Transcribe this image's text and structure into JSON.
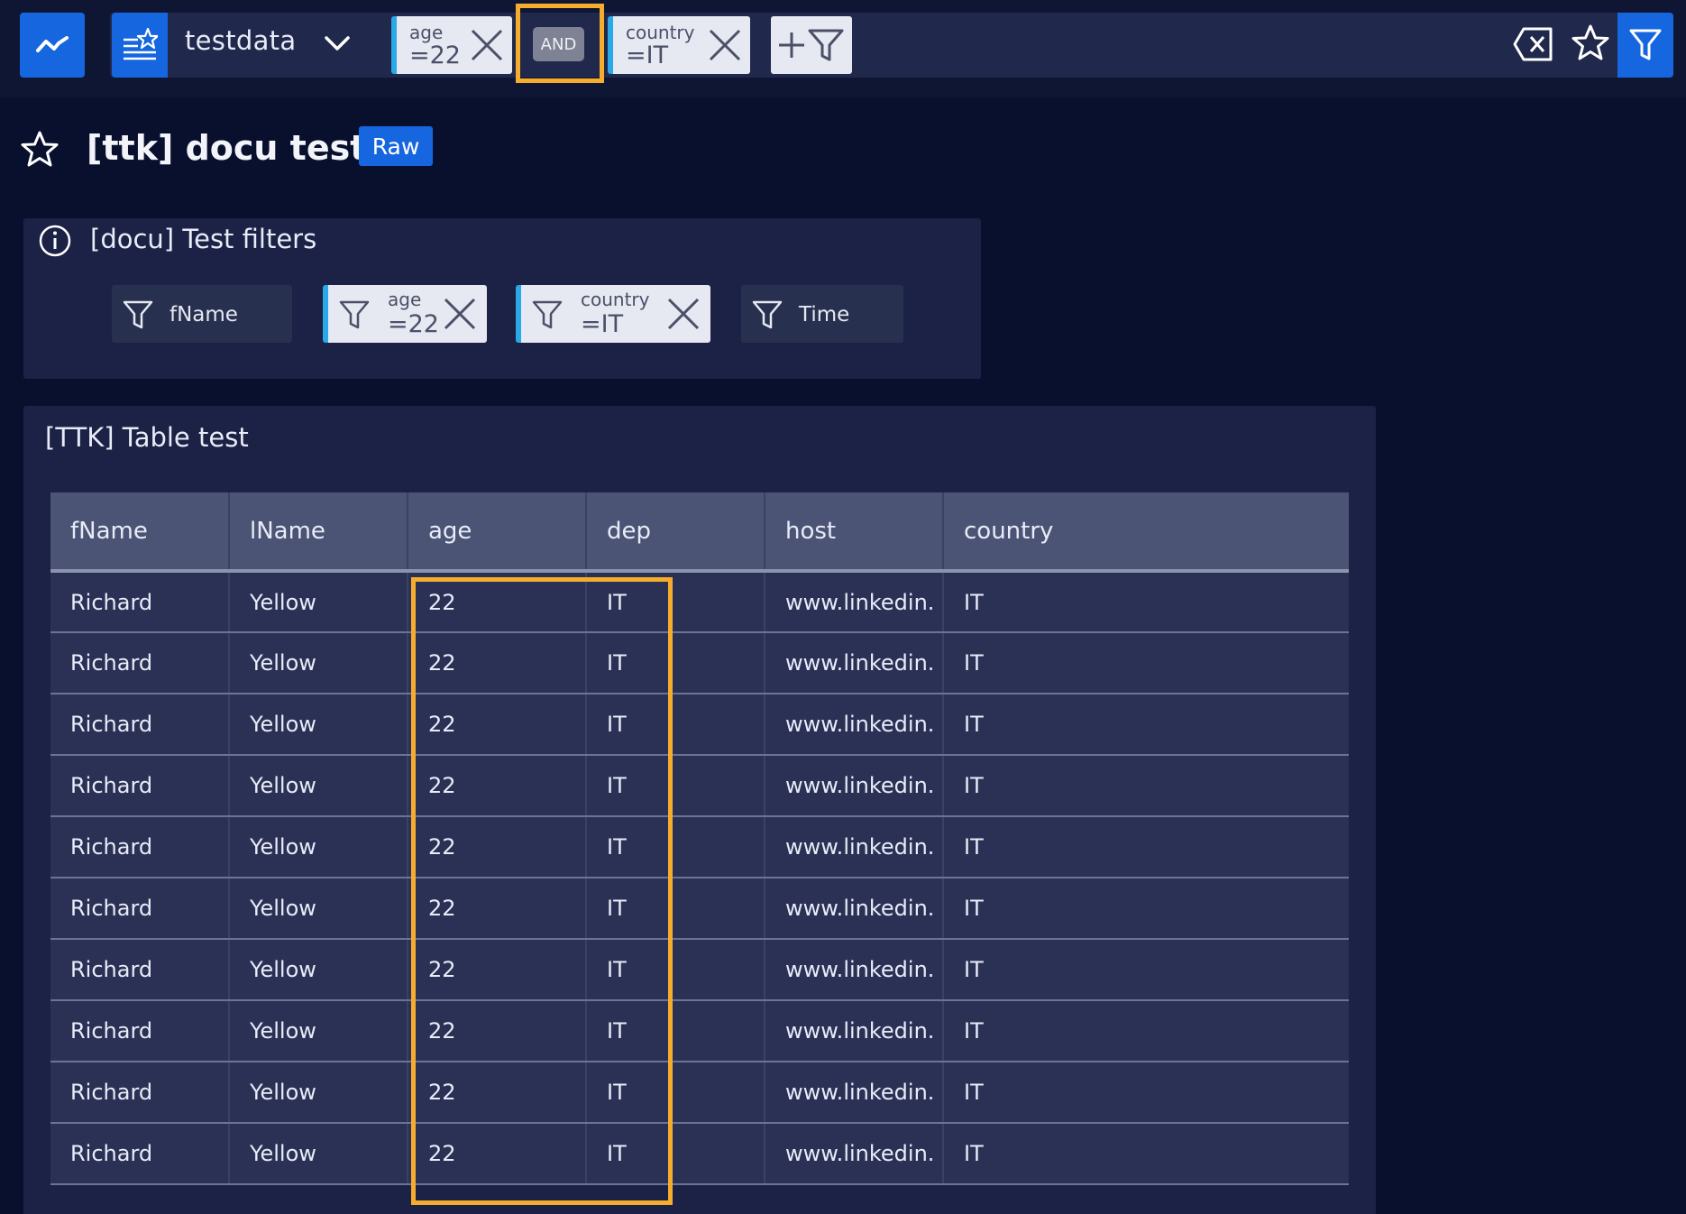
{
  "topbar": {
    "datasource_name": "testdata",
    "filters": [
      {
        "key": "age",
        "value": "=22"
      },
      {
        "key": "country",
        "value": "=IT"
      }
    ],
    "operator_label": "AND"
  },
  "page": {
    "title": "[ttk] docu test",
    "badge": "Raw"
  },
  "filters_panel": {
    "title": "[docu] Test filters",
    "chips": [
      {
        "label": "fName",
        "active": false
      },
      {
        "key": "age",
        "value": "=22",
        "active": true
      },
      {
        "key": "country",
        "value": "=IT",
        "active": true
      },
      {
        "label": "Time",
        "active": false
      }
    ]
  },
  "table": {
    "title": "[TTK] Table test",
    "columns": [
      "fName",
      "lName",
      "age",
      "dep",
      "host",
      "country"
    ],
    "rows": [
      [
        "Richard",
        "Yellow",
        "22",
        "IT",
        "www.linkedin.",
        "IT"
      ],
      [
        "Richard",
        "Yellow",
        "22",
        "IT",
        "www.linkedin.",
        "IT"
      ],
      [
        "Richard",
        "Yellow",
        "22",
        "IT",
        "www.linkedin.",
        "IT"
      ],
      [
        "Richard",
        "Yellow",
        "22",
        "IT",
        "www.linkedin.",
        "IT"
      ],
      [
        "Richard",
        "Yellow",
        "22",
        "IT",
        "www.linkedin.",
        "IT"
      ],
      [
        "Richard",
        "Yellow",
        "22",
        "IT",
        "www.linkedin.",
        "IT"
      ],
      [
        "Richard",
        "Yellow",
        "22",
        "IT",
        "www.linkedin.",
        "IT"
      ],
      [
        "Richard",
        "Yellow",
        "22",
        "IT",
        "www.linkedin.",
        "IT"
      ],
      [
        "Richard",
        "Yellow",
        "22",
        "IT",
        "www.linkedin.",
        "IT"
      ],
      [
        "Richard",
        "Yellow",
        "22",
        "IT",
        "www.linkedin.",
        "IT"
      ]
    ]
  },
  "icons": {
    "app": "line-chart-icon",
    "datasource": "datasource-icon",
    "clear": "clear-filters-icon",
    "favorite": "star-icon",
    "filter": "filter-icon",
    "info": "info-icon"
  },
  "colors": {
    "accent": "#1666e0",
    "highlight": "#f7ad2c",
    "active_filter_border": "#29a9e8",
    "background": "#08102e"
  }
}
